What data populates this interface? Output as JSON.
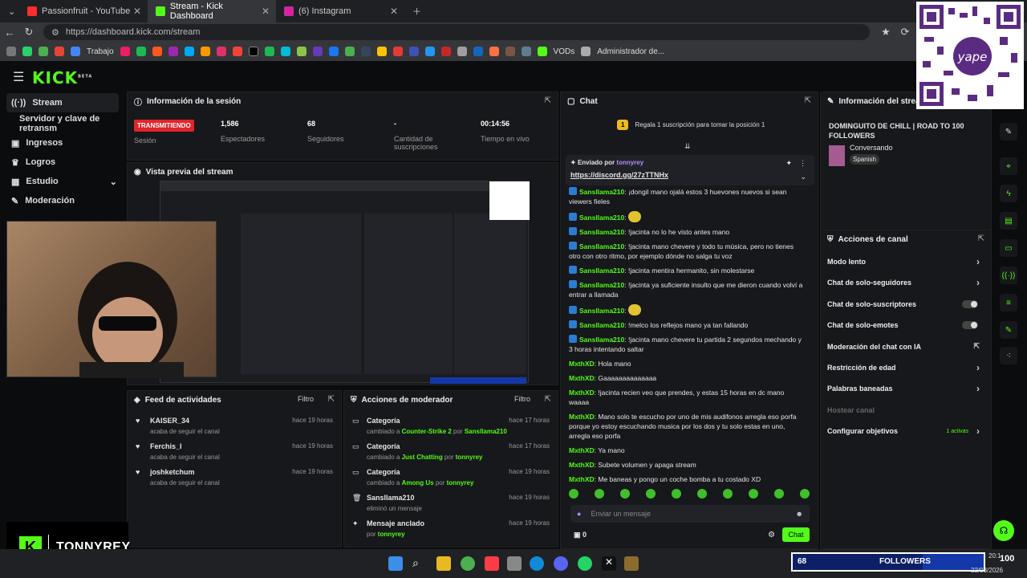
{
  "browser": {
    "tabs": [
      {
        "title": "Passionfruit - YouTube",
        "color": "#ff2d2d"
      },
      {
        "title": "Stream - Kick Dashboard",
        "color": "#53fc18"
      },
      {
        "title": "(6) Instagram",
        "color": "#d6249f"
      }
    ],
    "url": "https://dashboard.kick.com/stream",
    "bookmarks": [
      "Trabajo",
      "VODs",
      "Administrador de..."
    ]
  },
  "app": {
    "logo": "KICK",
    "logo_tag": "BETA",
    "sidebar": [
      {
        "label": "Stream",
        "icon": "stream-icon"
      },
      {
        "label": "Servidor y clave de retransm",
        "icon": ""
      },
      {
        "label": "Ingresos",
        "icon": "money-icon"
      },
      {
        "label": "Logros",
        "icon": "trophy-icon"
      },
      {
        "label": "Estudio",
        "icon": "studio-icon"
      },
      {
        "label": "Moderación",
        "icon": "wrench-icon"
      }
    ],
    "session": {
      "title": "Información de la sesión",
      "status": "TRANSMITIENDO",
      "status_label": "Sesión",
      "stats": [
        {
          "value": "1,586",
          "label": "Espectadores"
        },
        {
          "value": "68",
          "label": "Seguidores"
        },
        {
          "value": "-",
          "label": "Cantidad de suscripciones"
        },
        {
          "value": "00:14:56",
          "label": "Tiempo en vivo"
        }
      ]
    },
    "preview": {
      "title": "Vista previa del stream"
    },
    "feed": {
      "title": "Feed de actividades",
      "filter": "Filtro",
      "items": [
        {
          "name": "KAISER_34",
          "desc": "acaba de seguir el canal",
          "time": "hace 19 horas"
        },
        {
          "name": "Ferchis_I",
          "desc": "acaba de seguir el canal",
          "time": "hace 19 horas"
        },
        {
          "name": "joshketchum",
          "desc": "acaba de seguir el canal",
          "time": "hace 19 horas"
        }
      ]
    },
    "modactions": {
      "title": "Acciones de moderador",
      "filter": "Filtro",
      "items": [
        {
          "title": "Categoría",
          "pre": "cambiado a ",
          "hl": "Counter-Strike 2",
          "mid": " por ",
          "user": "Sansllama210",
          "time": "hace 17 horas"
        },
        {
          "title": "Categoría",
          "pre": "cambiado a ",
          "hl": "Just Chatting",
          "mid": " por ",
          "user": "tonnyrey",
          "time": "hace 17 horas"
        },
        {
          "title": "Categoría",
          "pre": "cambiado a ",
          "hl": "Among Us",
          "mid": " por ",
          "user": "tonnyrey",
          "time": "hace 19 horas"
        },
        {
          "title": "Sansllama210",
          "pre": "eliminó un mensaje",
          "hl": "",
          "mid": "",
          "user": "",
          "time": "hace 19 horas"
        },
        {
          "title": "Mensaje anclado",
          "pre": "por ",
          "hl": "",
          "mid": "",
          "user": "tonnyrey",
          "time": "hace 19 horas"
        }
      ]
    },
    "chat": {
      "title": "Chat",
      "promo": "Regala 1 suscripción para tomar la posición 1",
      "promo_rank": "1",
      "pinned_by": "Enviado por",
      "pinned_user": "tonnyrey",
      "pinned_link": "https://discord.gg/27zTTNHx",
      "messages": [
        {
          "user": "Sansllama210",
          "text": ": ¡dongil mano ojalá estos 3 huevones nuevos si sean viewers fieles",
          "kick": true
        },
        {
          "user": "Sansllama210",
          "text": ":",
          "kick": true,
          "emote": true
        },
        {
          "user": "Sansllama210",
          "text": ": !jacinta no lo he visto antes mano",
          "kick": true
        },
        {
          "user": "Sansllama210",
          "text": ": !jacinta mano chevere y todo tu música, pero no tienes otro con otro ritmo, por ejemplo dónde no salga tu voz",
          "kick": true
        },
        {
          "user": "Sansllama210",
          "text": ": !jacinta mentira hermanito, sin molestarse",
          "kick": true
        },
        {
          "user": "Sansllama210",
          "text": ": !jacinta ya suficiente insulto que me dieron cuando volví a entrar a llamada",
          "kick": true
        },
        {
          "user": "Sansllama210",
          "text": ":",
          "kick": true,
          "emote": true
        },
        {
          "user": "Sansllama210",
          "text": ": !melco los reflejos mano ya tan fallando",
          "kick": true
        },
        {
          "user": "Sansllama210",
          "text": ": !jacinta mano chevere tu partida 2 segundos mechando y 3 horas intentando saltar",
          "kick": true
        },
        {
          "user": "MxthXD",
          "text": ": Hola mano",
          "kick": false
        },
        {
          "user": "MxthXD",
          "text": ": Gaaaaaaaaaaaaaa",
          "kick": false
        },
        {
          "user": "MxthXD",
          "text": ": !jacinta recien veo que prendes, y estas 15 horas en dc mano waaaa",
          "kick": false
        },
        {
          "user": "MxthXD",
          "text": ": Mano solo te escucho por uno de mis audifonos arregla eso porfa porque yo estoy escuchando musica por los dos y tu solo estas en uno, arregla eso porfa",
          "kick": false
        },
        {
          "user": "MxthXD",
          "text": ": Ya mano",
          "kick": false
        },
        {
          "user": "MxthXD",
          "text": ": Subete volumen y apaga stream",
          "kick": false
        },
        {
          "user": "MxthXD",
          "text": ": Me baneas y pongo un coche bomba a tu costado XD",
          "kick": false
        }
      ],
      "input_placeholder": "Enviar un mensaje",
      "points": "0",
      "send": "Chat"
    },
    "channel": {
      "title": "Información del stream",
      "stream_title": "DOMINGUITO DE CHILL | ROAD TO 100 FOLLOWERS",
      "category": "Conversando",
      "language": "Spanish"
    },
    "channel_actions": {
      "title": "Acciones de canal",
      "items": [
        {
          "label": "Modo lento",
          "control": "chevron"
        },
        {
          "label": "Chat de solo-seguidores",
          "control": "chevron"
        },
        {
          "label": "Chat de solo-suscriptores",
          "control": "toggle"
        },
        {
          "label": "Chat de solo-emotes",
          "control": "toggle"
        },
        {
          "label": "Moderación del chat con IA",
          "control": "external"
        },
        {
          "label": "Restricción de edad",
          "control": "chevron"
        },
        {
          "label": "Palabras baneadas",
          "control": "chevron"
        },
        {
          "label": "Hostear canal",
          "control": "none"
        },
        {
          "label": "Configurar objetivos",
          "control": "chevron",
          "extra": "1 activas"
        }
      ]
    }
  },
  "overlay": {
    "streamer": "TONNYREY",
    "followers_count": "68",
    "followers_label": "FOLLOWERS",
    "qr_brand": "yape"
  },
  "taskbar": {
    "time": "20:1",
    "date": "22/03/2026",
    "volume": "100"
  },
  "colors": {
    "accent": "#53fc18",
    "live": "#e0242b",
    "bg": "#0b0c0e",
    "panel": "#17181b"
  }
}
